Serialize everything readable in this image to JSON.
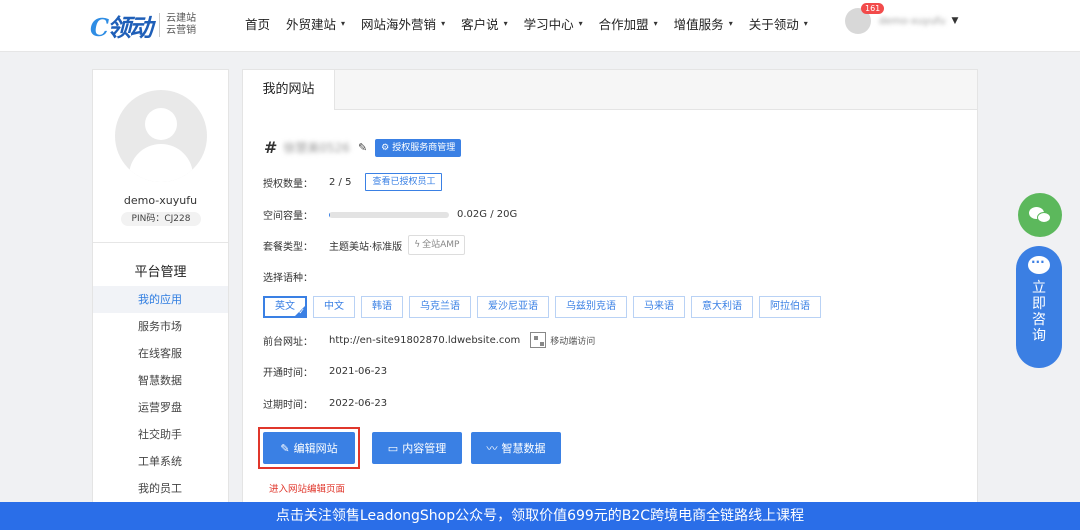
{
  "header": {
    "logo_text": "领动",
    "logo_sub_line1": "云建站",
    "logo_sub_line2": "云营销",
    "nav": [
      {
        "label": "首页",
        "has_dropdown": false
      },
      {
        "label": "外贸建站",
        "has_dropdown": true
      },
      {
        "label": "网站海外营销",
        "has_dropdown": true
      },
      {
        "label": "客户说",
        "has_dropdown": true
      },
      {
        "label": "学习中心",
        "has_dropdown": true
      },
      {
        "label": "合作加盟",
        "has_dropdown": true
      },
      {
        "label": "增值服务",
        "has_dropdown": true
      },
      {
        "label": "关于领动",
        "has_dropdown": true
      }
    ],
    "notification_count": "161",
    "username": "demo-xuyufu"
  },
  "sidebar": {
    "profile_name": "demo-xuyufu",
    "pin": "PIN码：CJ228",
    "menu_title": "平台管理",
    "items": [
      {
        "label": "我的应用",
        "active": true
      },
      {
        "label": "服务市场",
        "active": false
      },
      {
        "label": "在线客服",
        "active": false
      },
      {
        "label": "智慧数据",
        "active": false
      },
      {
        "label": "运营罗盘",
        "active": false
      },
      {
        "label": "社交助手",
        "active": false
      },
      {
        "label": "工单系统",
        "active": false
      },
      {
        "label": "我的员工",
        "active": false
      }
    ]
  },
  "main": {
    "tab": "我的网站",
    "site_hash": "#",
    "site_name_blurred": "徐慧美0526",
    "auth_button": "授权服务商管理",
    "auth_count": {
      "label": "授权数量：",
      "value": "2 / 5",
      "button": "查看已授权员工"
    },
    "storage": {
      "label": "空间容量：",
      "value": "0.02G / 20G",
      "fraction": 0.001
    },
    "plan": {
      "label": "套餐类型：",
      "value": "主题美站·标准版",
      "amp": "全站AMP"
    },
    "language_label": "选择语种：",
    "languages": [
      {
        "label": "英文",
        "active": true
      },
      {
        "label": "中文",
        "active": false
      },
      {
        "label": "韩语",
        "active": false
      },
      {
        "label": "乌克兰语",
        "active": false
      },
      {
        "label": "爱沙尼亚语",
        "active": false
      },
      {
        "label": "乌兹别克语",
        "active": false
      },
      {
        "label": "马来语",
        "active": false
      },
      {
        "label": "意大利语",
        "active": false
      },
      {
        "label": "阿拉伯语",
        "active": false
      }
    ],
    "frontend": {
      "label": "前台网址：",
      "url": "http://en-site91802870.ldwebsite.com",
      "mobile": "移动端访问"
    },
    "open_time": {
      "label": "开通时间：",
      "value": "2021-06-23"
    },
    "expire_time": {
      "label": "过期时间：",
      "value": "2022-06-23"
    },
    "buttons": {
      "edit": "编辑网站",
      "content": "内容管理",
      "data": "智慧数据"
    },
    "hint": "进入网站编辑页面"
  },
  "floating": {
    "consult": "立即咨询"
  },
  "banner": "点击关注领售LeadongShop公众号，领取价值699元的B2C跨境电商全链路线上课程",
  "colors": {
    "accent": "#3a80e4",
    "highlight": "#e0362b",
    "wechat": "#5cb85c",
    "banner": "#2a6ee8"
  }
}
